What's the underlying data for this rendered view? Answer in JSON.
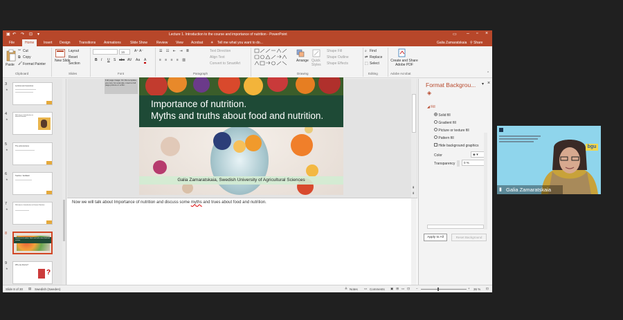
{
  "window": {
    "title": "Lecture 1. Introduction to the course and importance of nutrition - PowerPoint",
    "user_name": "Galia Zamaratskaia",
    "share_label": "Share"
  },
  "tabs": [
    "File",
    "Home",
    "Insert",
    "Design",
    "Transitions",
    "Animations",
    "Slide Show",
    "Review",
    "View",
    "Acrobat"
  ],
  "active_tab": "Home",
  "tell_me": "Tell me what you want to do...",
  "ribbon": {
    "clipboard": {
      "paste": "Paste",
      "cut": "Cut",
      "copy": "Copy",
      "format_painter": "Format Painter",
      "label": "Clipboard"
    },
    "slides": {
      "new_slide": "New Slide",
      "layout": "Layout",
      "reset": "Reset",
      "section": "Section",
      "label": "Slides"
    },
    "font": {
      "size": "16",
      "label": "Font",
      "buttons": [
        "B",
        "I",
        "U",
        "S",
        "abc",
        "AV",
        "Aa",
        "A"
      ]
    },
    "paragraph": {
      "text_direction": "Text Direction",
      "align_text": "Align Text",
      "convert_smartart": "Convert to SmartArt",
      "label": "Paragraph"
    },
    "drawing": {
      "arrange": "Arrange",
      "quick_styles": "Quick Styles",
      "shape_fill": "Shape Fill",
      "shape_outline": "Shape Outline",
      "shape_effects": "Shape Effects",
      "label": "Drawing"
    },
    "editing": {
      "find": "Find",
      "replace": "Replace",
      "select": "Select",
      "label": "Editing"
    },
    "acrobat": {
      "create_share": "Create and Share Adobe PDF",
      "label": "Adobe Acrobat"
    }
  },
  "thumbnails": [
    {
      "num": "3",
      "title": "Lectures and resources"
    },
    {
      "num": "4",
      "title": "Welcome to Introduction to Human Nutrition"
    },
    {
      "num": "5",
      "title": "The extra lectures"
    },
    {
      "num": "6",
      "title": "Teacher / facilitator"
    },
    {
      "num": "7",
      "title": "Welcome to Introduction to Human Nutrition"
    },
    {
      "num": "8",
      "title": "Importance of nutrition. Myths and truths about food and nutrition."
    },
    {
      "num": "9",
      "title": "Why we diverse?"
    }
  ],
  "sticky_note": "Full page image: On this template, you can, for example, insert a full page picture or a film.",
  "slide": {
    "title_line1": "Importance of nutrition.",
    "title_line2": "Myths and truths about food and nutrition.",
    "author": "Galia Zamaratskaia, Swedish University of Agricultural Sciences"
  },
  "notes": {
    "before": "Now we will talk about Importance of nutrition and discuss some ",
    "misspelled": "myths",
    "after": " and trues about food and nutrition."
  },
  "format_pane": {
    "title": "Format Backgrou...",
    "section": "Fill",
    "options": [
      "Solid fill",
      "Gradient fill",
      "Picture or texture fill",
      "Pattern fill"
    ],
    "selected_option": "Solid fill",
    "hide_graphics": "Hide background graphics",
    "color_label": "Color",
    "transparency_label": "Transparency",
    "transparency_value": "0 %",
    "apply_all": "Apply to All",
    "reset": "Reset Background"
  },
  "status": {
    "slide_of": "Slide 8 of 30",
    "language": "Swedish (Sweden)",
    "notes": "Notes",
    "comments": "Comments",
    "zoom": "36 %"
  },
  "video": {
    "participant": "Galia Zamaratskaia",
    "badge": "bgu"
  }
}
